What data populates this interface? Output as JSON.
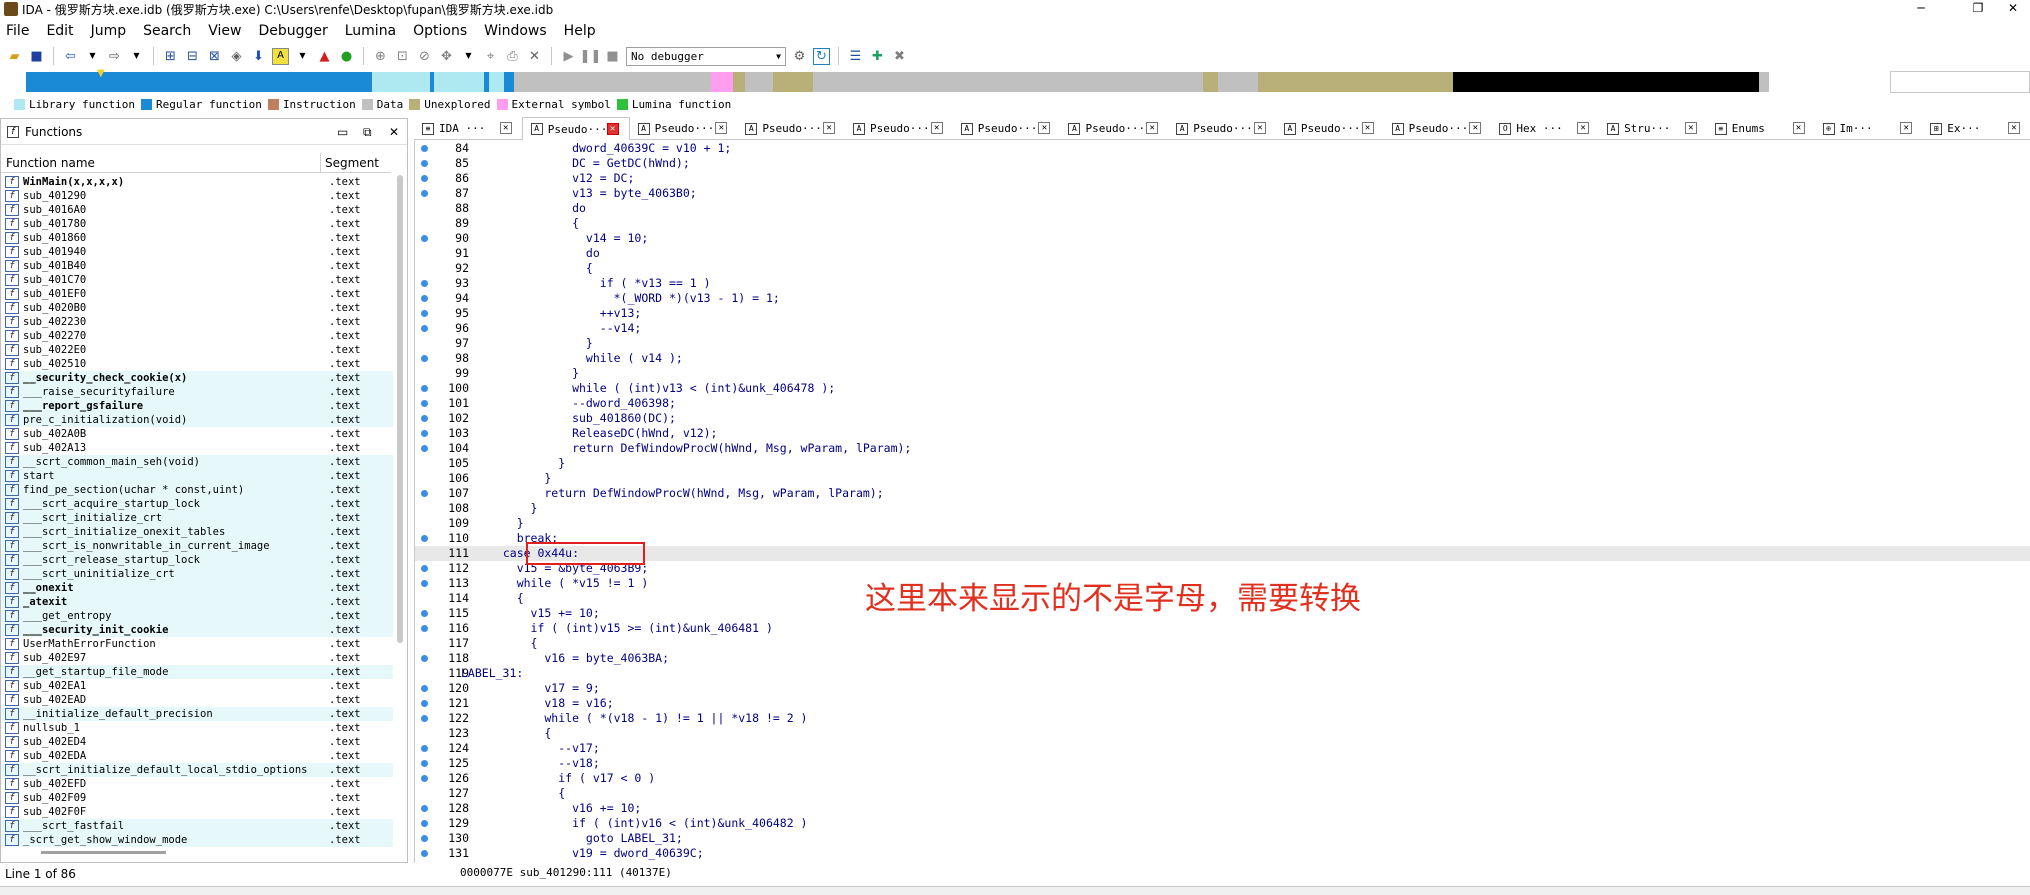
{
  "window": {
    "title": "IDA - 俄罗斯方块.exe.idb (俄罗斯方块.exe) C:\\Users\\renfe\\Desktop\\fupan\\俄罗斯方块.exe.idb",
    "minimize": "─",
    "maximize": "❐",
    "close": "✕"
  },
  "menu": [
    "File",
    "Edit",
    "Jump",
    "Search",
    "View",
    "Debugger",
    "Lumina",
    "Options",
    "Windows",
    "Help"
  ],
  "toolbar": {
    "debugger_select": "No debugger"
  },
  "legend": [
    {
      "label": "Library function",
      "color": "#aee8f0"
    },
    {
      "label": "Regular function",
      "color": "#1a8ad6"
    },
    {
      "label": "Instruction",
      "color": "#c08060"
    },
    {
      "label": "Data",
      "color": "#c0c0c0"
    },
    {
      "label": "Unexplored",
      "color": "#b8b078"
    },
    {
      "label": "External symbol",
      "color": "#ff9ef0"
    },
    {
      "label": "Lumina function",
      "color": "#30c040"
    }
  ],
  "functions_panel": {
    "title": "Functions",
    "col_name": "Function name",
    "col_segment": "Segment",
    "rows": [
      {
        "name": "WinMain(x,x,x,x)",
        "seg": ".text",
        "bold": true,
        "lib": false,
        "sel": true
      },
      {
        "name": "sub_401290",
        "seg": ".text",
        "bold": false,
        "lib": false
      },
      {
        "name": "sub_4016A0",
        "seg": ".text",
        "bold": false,
        "lib": false
      },
      {
        "name": "sub_401780",
        "seg": ".text",
        "bold": false,
        "lib": false
      },
      {
        "name": "sub_401860",
        "seg": ".text",
        "bold": false,
        "lib": false
      },
      {
        "name": "sub_401940",
        "seg": ".text",
        "bold": false,
        "lib": false
      },
      {
        "name": "sub_401B40",
        "seg": ".text",
        "bold": false,
        "lib": false
      },
      {
        "name": "sub_401C70",
        "seg": ".text",
        "bold": false,
        "lib": false
      },
      {
        "name": "sub_401EF0",
        "seg": ".text",
        "bold": false,
        "lib": false
      },
      {
        "name": "sub_4020B0",
        "seg": ".text",
        "bold": false,
        "lib": false
      },
      {
        "name": "sub_402230",
        "seg": ".text",
        "bold": false,
        "lib": false
      },
      {
        "name": "sub_402270",
        "seg": ".text",
        "bold": false,
        "lib": false
      },
      {
        "name": "sub_4022E0",
        "seg": ".text",
        "bold": false,
        "lib": false
      },
      {
        "name": "sub_402510",
        "seg": ".text",
        "bold": false,
        "lib": false
      },
      {
        "name": "__security_check_cookie(x)",
        "seg": ".text",
        "bold": true,
        "lib": true
      },
      {
        "name": "___raise_securityfailure",
        "seg": ".text",
        "bold": false,
        "lib": true
      },
      {
        "name": "___report_gsfailure",
        "seg": ".text",
        "bold": true,
        "lib": true
      },
      {
        "name": "pre_c_initialization(void)",
        "seg": ".text",
        "bold": false,
        "lib": true
      },
      {
        "name": "sub_402A0B",
        "seg": ".text",
        "bold": false,
        "lib": false
      },
      {
        "name": "sub_402A13",
        "seg": ".text",
        "bold": false,
        "lib": false
      },
      {
        "name": "__scrt_common_main_seh(void)",
        "seg": ".text",
        "bold": false,
        "lib": true
      },
      {
        "name": "start",
        "seg": ".text",
        "bold": false,
        "lib": true
      },
      {
        "name": "find_pe_section(uchar * const,uint)",
        "seg": ".text",
        "bold": false,
        "lib": true
      },
      {
        "name": "___scrt_acquire_startup_lock",
        "seg": ".text",
        "bold": false,
        "lib": true
      },
      {
        "name": "___scrt_initialize_crt",
        "seg": ".text",
        "bold": false,
        "lib": true
      },
      {
        "name": "___scrt_initialize_onexit_tables",
        "seg": ".text",
        "bold": false,
        "lib": true
      },
      {
        "name": "___scrt_is_nonwritable_in_current_image",
        "seg": ".text",
        "bold": false,
        "lib": true
      },
      {
        "name": "___scrt_release_startup_lock",
        "seg": ".text",
        "bold": false,
        "lib": true
      },
      {
        "name": "___scrt_uninitialize_crt",
        "seg": ".text",
        "bold": false,
        "lib": true
      },
      {
        "name": "__onexit",
        "seg": ".text",
        "bold": true,
        "lib": true
      },
      {
        "name": "_atexit",
        "seg": ".text",
        "bold": true,
        "lib": true
      },
      {
        "name": "___get_entropy",
        "seg": ".text",
        "bold": false,
        "lib": true
      },
      {
        "name": "___security_init_cookie",
        "seg": ".text",
        "bold": true,
        "lib": true
      },
      {
        "name": "UserMathErrorFunction",
        "seg": ".text",
        "bold": false,
        "lib": false
      },
      {
        "name": "sub_402E97",
        "seg": ".text",
        "bold": false,
        "lib": false
      },
      {
        "name": "__get_startup_file_mode",
        "seg": ".text",
        "bold": false,
        "lib": true
      },
      {
        "name": "sub_402EA1",
        "seg": ".text",
        "bold": false,
        "lib": false
      },
      {
        "name": "sub_402EAD",
        "seg": ".text",
        "bold": false,
        "lib": false
      },
      {
        "name": "__initialize_default_precision",
        "seg": ".text",
        "bold": false,
        "lib": true
      },
      {
        "name": "nullsub_1",
        "seg": ".text",
        "bold": false,
        "lib": false
      },
      {
        "name": "sub_402ED4",
        "seg": ".text",
        "bold": false,
        "lib": false
      },
      {
        "name": "sub_402EDA",
        "seg": ".text",
        "bold": false,
        "lib": false
      },
      {
        "name": "__scrt_initialize_default_local_stdio_options",
        "seg": ".text",
        "bold": false,
        "lib": true
      },
      {
        "name": "sub_402EFD",
        "seg": ".text",
        "bold": false,
        "lib": false
      },
      {
        "name": "sub_402F09",
        "seg": ".text",
        "bold": false,
        "lib": false
      },
      {
        "name": "sub_402F0F",
        "seg": ".text",
        "bold": false,
        "lib": false
      },
      {
        "name": "___scrt_fastfail",
        "seg": ".text",
        "bold": false,
        "lib": true
      },
      {
        "name": "_scrt_get_show_window_mode",
        "seg": ".text",
        "bold": false,
        "lib": true
      }
    ],
    "status": "Line 1 of 86"
  },
  "tabs": [
    {
      "label": "IDA ···",
      "icon": "≡",
      "active": false
    },
    {
      "label": "Pseudo···",
      "icon": "A",
      "active": true
    },
    {
      "label": "Pseudo···",
      "icon": "A",
      "active": false
    },
    {
      "label": "Pseudo···",
      "icon": "A",
      "active": false
    },
    {
      "label": "Pseudo···",
      "icon": "A",
      "active": false
    },
    {
      "label": "Pseudo···",
      "icon": "A",
      "active": false
    },
    {
      "label": "Pseudo···",
      "icon": "A",
      "active": false
    },
    {
      "label": "Pseudo···",
      "icon": "A",
      "active": false
    },
    {
      "label": "Pseudo···",
      "icon": "A",
      "active": false
    },
    {
      "label": "Pseudo···",
      "icon": "A",
      "active": false
    },
    {
      "label": "Hex ···",
      "icon": "O",
      "active": false
    },
    {
      "label": "Stru···",
      "icon": "A",
      "active": false
    },
    {
      "label": "Enums",
      "icon": "≡",
      "active": false
    },
    {
      "label": "Im···",
      "icon": "⊕",
      "active": false
    },
    {
      "label": "Ex···",
      "icon": "⊞",
      "active": false
    }
  ],
  "code_lines": [
    {
      "n": "84",
      "dot": true,
      "t": "            dword_40639C = v10 + 1;"
    },
    {
      "n": "85",
      "dot": true,
      "t": "            DC = GetDC(hWnd);"
    },
    {
      "n": "86",
      "dot": true,
      "t": "            v12 = DC;"
    },
    {
      "n": "87",
      "dot": true,
      "t": "            v13 = byte_4063B0;"
    },
    {
      "n": "88",
      "dot": false,
      "t": "            do"
    },
    {
      "n": "89",
      "dot": false,
      "t": "            {"
    },
    {
      "n": "90",
      "dot": true,
      "t": "              v14 = 10;"
    },
    {
      "n": "91",
      "dot": false,
      "t": "              do"
    },
    {
      "n": "92",
      "dot": false,
      "t": "              {"
    },
    {
      "n": "93",
      "dot": true,
      "t": "                if ( *v13 == 1 )"
    },
    {
      "n": "94",
      "dot": true,
      "t": "                  *(_WORD *)(v13 - 1) = 1;"
    },
    {
      "n": "95",
      "dot": true,
      "t": "                ++v13;"
    },
    {
      "n": "96",
      "dot": true,
      "t": "                --v14;"
    },
    {
      "n": "97",
      "dot": false,
      "t": "              }"
    },
    {
      "n": "98",
      "dot": true,
      "t": "              while ( v14 );"
    },
    {
      "n": "99",
      "dot": false,
      "t": "            }"
    },
    {
      "n": "100",
      "dot": true,
      "t": "            while ( (int)v13 < (int)&unk_406478 );"
    },
    {
      "n": "101",
      "dot": true,
      "t": "            --dword_406398;"
    },
    {
      "n": "102",
      "dot": true,
      "t": "            sub_401860(DC);"
    },
    {
      "n": "103",
      "dot": true,
      "t": "            ReleaseDC(hWnd, v12);"
    },
    {
      "n": "104",
      "dot": true,
      "t": "            return DefWindowProcW(hWnd, Msg, wParam, lParam);"
    },
    {
      "n": "105",
      "dot": false,
      "t": "          }"
    },
    {
      "n": "106",
      "dot": false,
      "t": "        }"
    },
    {
      "n": "107",
      "dot": true,
      "t": "        return DefWindowProcW(hWnd, Msg, wParam, lParam);"
    },
    {
      "n": "108",
      "dot": false,
      "t": "      }"
    },
    {
      "n": "109",
      "dot": false,
      "t": "    }"
    },
    {
      "n": "110",
      "dot": true,
      "t": "    break;"
    },
    {
      "n": "111",
      "dot": false,
      "t": "  case 0x44u:",
      "hl": true
    },
    {
      "n": "112",
      "dot": true,
      "t": "    v15 = &byte_4063B9;"
    },
    {
      "n": "113",
      "dot": true,
      "t": "    while ( *v15 != 1 )"
    },
    {
      "n": "114",
      "dot": false,
      "t": "    {"
    },
    {
      "n": "115",
      "dot": true,
      "t": "      v15 += 10;"
    },
    {
      "n": "116",
      "dot": true,
      "t": "      if ( (int)v15 >= (int)&unk_406481 )"
    },
    {
      "n": "117",
      "dot": false,
      "t": "      {"
    },
    {
      "n": "118",
      "dot": true,
      "t": "        v16 = byte_4063BA;"
    },
    {
      "n": "119",
      "dot": false,
      "t": "LABEL_31:",
      "label": true
    },
    {
      "n": "120",
      "dot": true,
      "t": "        v17 = 9;"
    },
    {
      "n": "121",
      "dot": true,
      "t": "        v18 = v16;"
    },
    {
      "n": "122",
      "dot": true,
      "t": "        while ( *(v18 - 1) != 1 || *v18 != 2 )"
    },
    {
      "n": "123",
      "dot": false,
      "t": "        {"
    },
    {
      "n": "124",
      "dot": true,
      "t": "          --v17;"
    },
    {
      "n": "125",
      "dot": true,
      "t": "          --v18;"
    },
    {
      "n": "126",
      "dot": true,
      "t": "          if ( v17 < 0 )"
    },
    {
      "n": "127",
      "dot": false,
      "t": "          {"
    },
    {
      "n": "128",
      "dot": true,
      "t": "            v16 += 10;"
    },
    {
      "n": "129",
      "dot": true,
      "t": "            if ( (int)v16 < (int)&unk_406482 )"
    },
    {
      "n": "130",
      "dot": true,
      "t": "              goto LABEL_31;"
    },
    {
      "n": "131",
      "dot": true,
      "t": "            v19 = dword_40639C;"
    }
  ],
  "annotation": "这里本来显示的不是字母，需要转换",
  "code_status": "0000077E sub_401290:111 (40137E)"
}
